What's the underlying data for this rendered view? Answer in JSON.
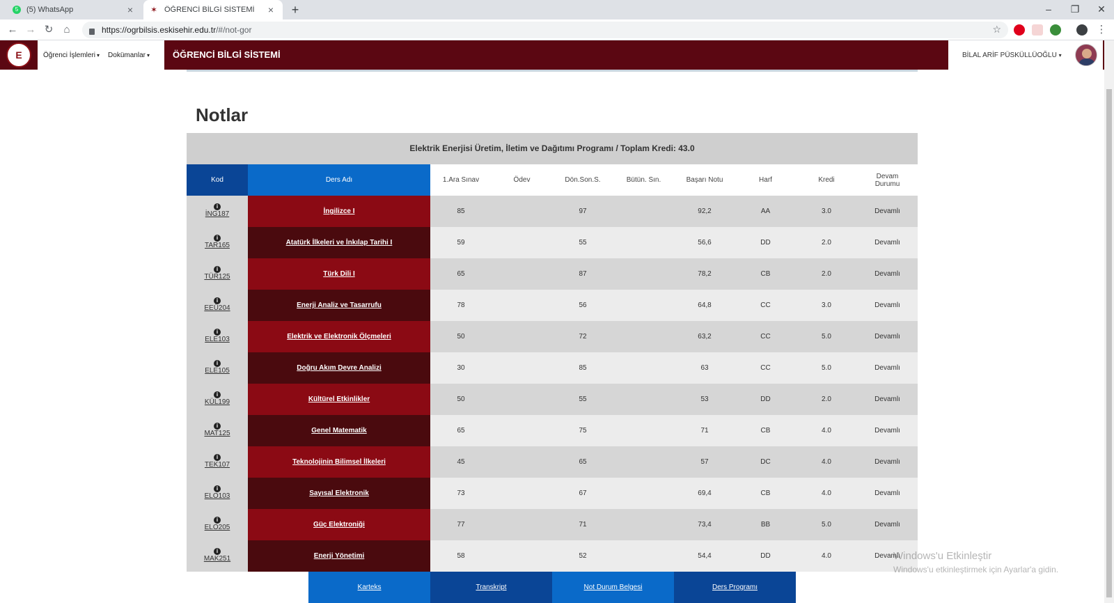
{
  "browser": {
    "tabs": [
      {
        "title": "(5) WhatsApp",
        "badge": "5"
      },
      {
        "title": "ÖĞRENCİ BİLGİ SİSTEMİ"
      }
    ],
    "url_host": "https://ogrbilsis.eskisehir.edu.tr",
    "url_path": "/#/not-gor"
  },
  "header": {
    "menu": [
      "Öğrenci İşlemleri",
      "Dokümanlar"
    ],
    "app_title": "ÖĞRENCİ BİLGİ SİSTEMİ",
    "username": "BİLAL ARİF PÜSKÜLLÜOĞLU"
  },
  "page": {
    "title": "Notlar",
    "program": "Elektrik Enerjisi Üretim, İletim ve Dağıtımı Programı / Toplam Kredi: 43.0"
  },
  "table": {
    "columns": [
      "Kod",
      "Ders Adı",
      "1.Ara Sınav",
      "Ödev",
      "Dön.Son.S.",
      "Bütün. Sın.",
      "Başarı Notu",
      "Harf",
      "Kredi",
      "Devam Durumu"
    ],
    "rows": [
      {
        "kod": "İNG187",
        "ders": "İngilizce I",
        "ara": "85",
        "odev": "",
        "donson": "97",
        "butun": "",
        "basari": "92,2",
        "harf": "AA",
        "kredi": "3.0",
        "devam": "Devamlı"
      },
      {
        "kod": "TAR165",
        "ders": "Atatürk İlkeleri ve İnkılap Tarihi I",
        "ara": "59",
        "odev": "",
        "donson": "55",
        "butun": "",
        "basari": "56,6",
        "harf": "DD",
        "kredi": "2.0",
        "devam": "Devamlı"
      },
      {
        "kod": "TÜR125",
        "ders": "Türk Dili I",
        "ara": "65",
        "odev": "",
        "donson": "87",
        "butun": "",
        "basari": "78,2",
        "harf": "CB",
        "kredi": "2.0",
        "devam": "Devamlı"
      },
      {
        "kod": "EEÜ204",
        "ders": "Enerji Analiz ve Tasarrufu",
        "ara": "78",
        "odev": "",
        "donson": "56",
        "butun": "",
        "basari": "64,8",
        "harf": "CC",
        "kredi": "3.0",
        "devam": "Devamlı"
      },
      {
        "kod": "ELE103",
        "ders": "Elektrik ve Elektronik Ölçmeleri",
        "ara": "50",
        "odev": "",
        "donson": "72",
        "butun": "",
        "basari": "63,2",
        "harf": "CC",
        "kredi": "5.0",
        "devam": "Devamlı"
      },
      {
        "kod": "ELE105",
        "ders": "Doğru Akım Devre Analizi",
        "ara": "30",
        "odev": "",
        "donson": "85",
        "butun": "",
        "basari": "63",
        "harf": "CC",
        "kredi": "5.0",
        "devam": "Devamlı"
      },
      {
        "kod": "KÜL199",
        "ders": "Kültürel Etkinlikler",
        "ara": "50",
        "odev": "",
        "donson": "55",
        "butun": "",
        "basari": "53",
        "harf": "DD",
        "kredi": "2.0",
        "devam": "Devamlı"
      },
      {
        "kod": "MAT125",
        "ders": "Genel Matematik",
        "ara": "65",
        "odev": "",
        "donson": "75",
        "butun": "",
        "basari": "71",
        "harf": "CB",
        "kredi": "4.0",
        "devam": "Devamlı"
      },
      {
        "kod": "TEK107",
        "ders": "Teknolojinin Bilimsel İlkeleri",
        "ara": "45",
        "odev": "",
        "donson": "65",
        "butun": "",
        "basari": "57",
        "harf": "DC",
        "kredi": "4.0",
        "devam": "Devamlı"
      },
      {
        "kod": "ELO103",
        "ders": "Sayısal Elektronik",
        "ara": "73",
        "odev": "",
        "donson": "67",
        "butun": "",
        "basari": "69,4",
        "harf": "CB",
        "kredi": "4.0",
        "devam": "Devamlı"
      },
      {
        "kod": "ELO205",
        "ders": "Güç Elektroniği",
        "ara": "77",
        "odev": "",
        "donson": "71",
        "butun": "",
        "basari": "73,4",
        "harf": "BB",
        "kredi": "5.0",
        "devam": "Devamlı"
      },
      {
        "kod": "MAK251",
        "ders": "Enerji Yönetimi",
        "ara": "58",
        "odev": "",
        "donson": "52",
        "butun": "",
        "basari": "54,4",
        "harf": "DD",
        "kredi": "4.0",
        "devam": "Devamlı"
      }
    ]
  },
  "footer_nav": [
    "Karteks",
    "Transkript",
    "Not Durum Belgesi",
    "Ders Programı"
  ],
  "watermark": {
    "title": "Windows'u Etkinleştir",
    "subtitle": "Windows'u etkinleştirmek için Ayarlar'a gidin."
  },
  "colors": {
    "brand": "#5b0712",
    "row_red": "#8b0a14",
    "row_dark": "#4a0a0e",
    "blue_dark": "#0a4596",
    "blue_light": "#0a6ac9"
  }
}
